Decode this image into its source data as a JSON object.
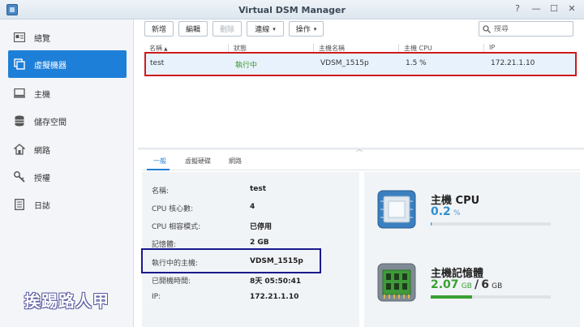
{
  "window": {
    "title": "Virtual DSM Manager",
    "controls": {
      "help": "?",
      "min": "—",
      "max": "☐",
      "close": "✕"
    }
  },
  "sidebar": {
    "items": [
      {
        "label": "總覽",
        "icon": "overview-icon"
      },
      {
        "label": "虛擬機器",
        "icon": "vm-icon",
        "active": true
      },
      {
        "label": "主機",
        "icon": "host-icon"
      },
      {
        "label": "儲存空間",
        "icon": "storage-icon"
      },
      {
        "label": "網路",
        "icon": "network-icon"
      },
      {
        "label": "授權",
        "icon": "license-key-icon"
      },
      {
        "label": "日誌",
        "icon": "log-icon"
      }
    ]
  },
  "toolbar": {
    "add_label": "新增",
    "edit_label": "編輯",
    "delete_label": "刪除",
    "connect_label": "連線",
    "action_label": "操作",
    "search_placeholder": "搜尋"
  },
  "grid": {
    "columns": [
      "名稱",
      "狀態",
      "主機名稱",
      "主機 CPU",
      "IP"
    ],
    "rows": [
      {
        "name": "test",
        "status": "執行中",
        "host": "VDSM_1515p",
        "cpu": "1.5 %",
        "ip": "172.21.1.10"
      }
    ]
  },
  "tabs": [
    "一般",
    "虛擬硬碟",
    "網路"
  ],
  "details": [
    {
      "label": "名稱:",
      "value": "test"
    },
    {
      "label": "CPU 核心數:",
      "value": "4"
    },
    {
      "label": "CPU 相容模式:",
      "value": "已停用"
    },
    {
      "label": "記憶體:",
      "value": "2 GB"
    },
    {
      "label": "執行中的主機:",
      "value": "VDSM_1515p"
    },
    {
      "label": "已開機時間:",
      "value": "8天 05:50:41"
    },
    {
      "label": "IP:",
      "value": "172.21.1.10"
    }
  ],
  "resources": {
    "cpu": {
      "title": "主機 CPU",
      "value": "0.2",
      "unit": "%",
      "fraction": 0.002,
      "color": "#2f8fd0"
    },
    "memory": {
      "title": "主機記憶體",
      "used": "2.07",
      "used_unit": "GB",
      "sep": "/",
      "total": "6",
      "total_unit": "GB",
      "fraction": 0.345,
      "color": "#39a032"
    }
  },
  "watermark": "挨踢路人甲",
  "annotation_colors": {
    "grid_row_box": "#cf1b1b",
    "host_row_box": "#1a1a8c"
  }
}
